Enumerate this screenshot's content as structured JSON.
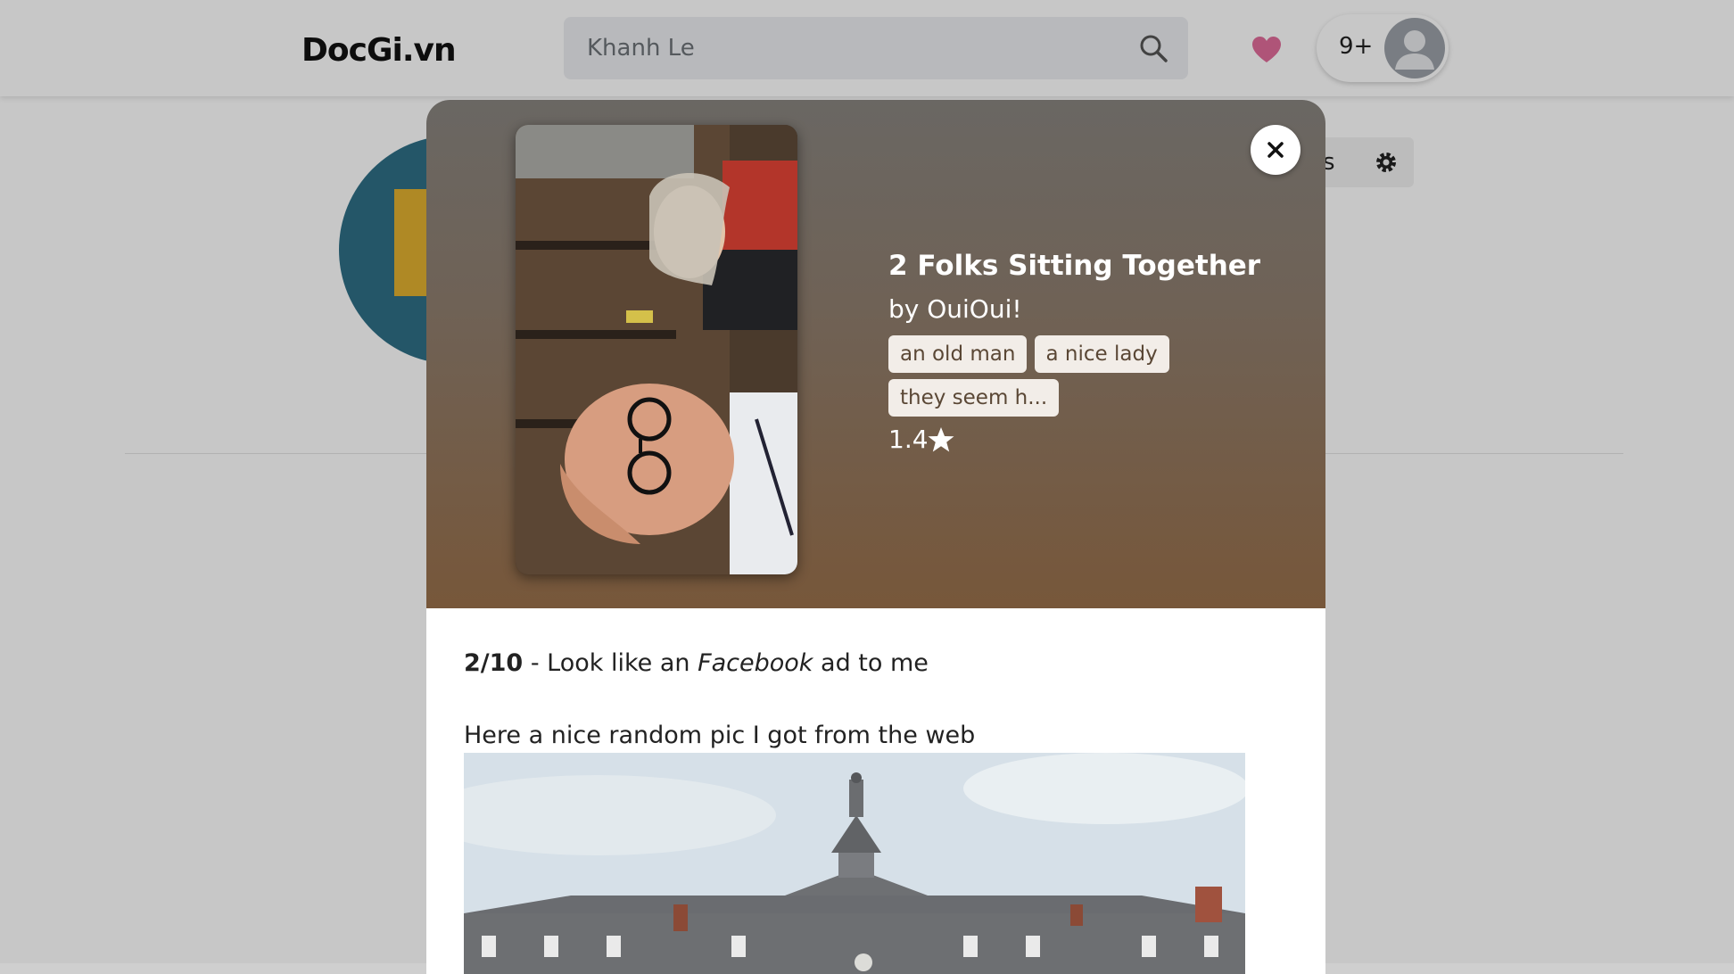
{
  "app": {
    "logo": "DocGi.vn"
  },
  "search": {
    "placeholder": "Khanh Le"
  },
  "header": {
    "notification_count": "9+"
  },
  "profile": {
    "settings_label": "ngs"
  },
  "modal": {
    "title": "2 Folks Sitting Together",
    "author": "by OuiOui!",
    "tags": [
      "an old man",
      "a nice lady",
      "they seem h..."
    ],
    "rating": "1.4",
    "review": {
      "score": "2/10",
      "text_before": " - Look like an ",
      "emphasis": "Facebook",
      "text_after": " ad to me",
      "line2": "Here a nice random pic I got from the web"
    }
  },
  "colors": {
    "heart": "#e06c9a",
    "header_gradient_top": "#6a6763",
    "header_gradient_bottom": "#77573a"
  }
}
